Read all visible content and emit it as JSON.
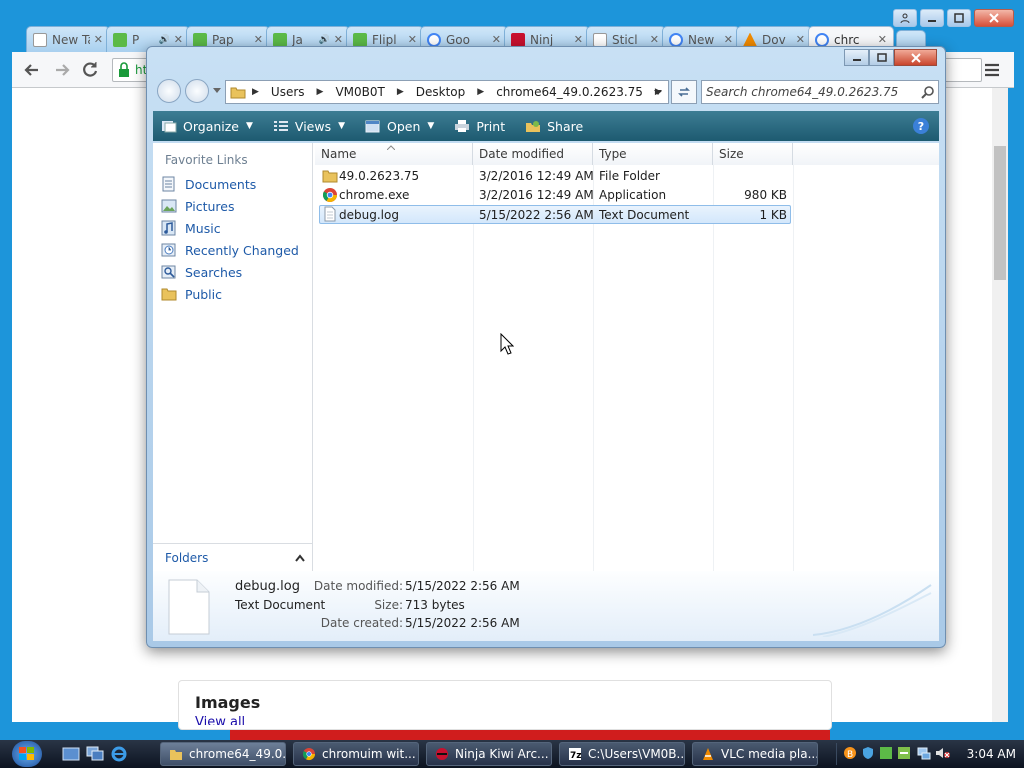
{
  "browser": {
    "tabs": [
      {
        "label": "New Ta",
        "icon": "blank-page-icon",
        "closable": true
      },
      {
        "label": "P",
        "icon": "green-app-icon",
        "audio": true
      },
      {
        "label": "Pap",
        "icon": "green-app-icon"
      },
      {
        "label": "Ja",
        "icon": "green-app-icon",
        "audio": true
      },
      {
        "label": "Flipl",
        "icon": "green-app-icon"
      },
      {
        "label": "Goo",
        "icon": "google-icon"
      },
      {
        "label": "Ninj",
        "icon": "ninja-kiwi-icon"
      },
      {
        "label": "Sticl",
        "icon": "blank-page-icon"
      },
      {
        "label": "New",
        "icon": "google-icon"
      },
      {
        "label": "Dov",
        "icon": "vlc-icon"
      },
      {
        "label": "chrc",
        "icon": "google-icon",
        "active": true
      }
    ],
    "url_fragment": "ht",
    "page": {
      "images_heading": "Images",
      "view_all": "View all"
    }
  },
  "explorer": {
    "breadcrumb": [
      "Users",
      "VM0B0T",
      "Desktop",
      "chrome64_49.0.2623.75"
    ],
    "search_placeholder": "Search chrome64_49.0.2623.75",
    "commands": [
      {
        "label": "Organize",
        "icon": "organize-icon",
        "dropdown": true
      },
      {
        "label": "Views",
        "icon": "views-icon",
        "dropdown": true
      },
      {
        "label": "Open",
        "icon": "open-icon",
        "dropdown": true
      },
      {
        "label": "Print",
        "icon": "print-icon",
        "dropdown": false
      },
      {
        "label": "Share",
        "icon": "share-icon",
        "dropdown": false
      }
    ],
    "favorite_links_title": "Favorite Links",
    "favorite_links": [
      {
        "label": "Documents",
        "icon": "documents-icon"
      },
      {
        "label": "Pictures",
        "icon": "pictures-icon"
      },
      {
        "label": "Music",
        "icon": "music-icon"
      },
      {
        "label": "Recently Changed",
        "icon": "recently-changed-icon"
      },
      {
        "label": "Searches",
        "icon": "searches-icon"
      },
      {
        "label": "Public",
        "icon": "public-folder-icon"
      }
    ],
    "folders_label": "Folders",
    "columns": [
      "Name",
      "Date modified",
      "Type",
      "Size"
    ],
    "files": [
      {
        "name": "49.0.2623.75",
        "date": "3/2/2016 12:49 AM",
        "type": "File Folder",
        "size": "",
        "icon": "folder-icon"
      },
      {
        "name": "chrome.exe",
        "date": "3/2/2016 12:49 AM",
        "type": "Application",
        "size": "980 KB",
        "icon": "chrome-icon"
      },
      {
        "name": "debug.log",
        "date": "5/15/2022 2:56 AM",
        "type": "Text Document",
        "size": "1 KB",
        "icon": "text-file-icon",
        "selected": true
      }
    ],
    "details": {
      "filename": "debug.log",
      "filetype": "Text Document",
      "date_modified_label": "Date modified:",
      "date_modified": "5/15/2022 2:56 AM",
      "size_label": "Size:",
      "size": "713 bytes",
      "date_created_label": "Date created:",
      "date_created": "5/15/2022 2:56 AM"
    }
  },
  "taskbar": {
    "buttons": [
      {
        "label": "chrome64_49.0...",
        "icon": "folder-icon",
        "active": true
      },
      {
        "label": "chromuim wit...",
        "icon": "chrome-icon"
      },
      {
        "label": "Ninja Kiwi Arc...",
        "icon": "ninja-kiwi-icon"
      },
      {
        "label": "C:\\Users\\VM0B...",
        "icon": "7zip-icon"
      },
      {
        "label": "VLC media pla...",
        "icon": "vlc-icon"
      }
    ],
    "clock": "3:04 AM"
  }
}
